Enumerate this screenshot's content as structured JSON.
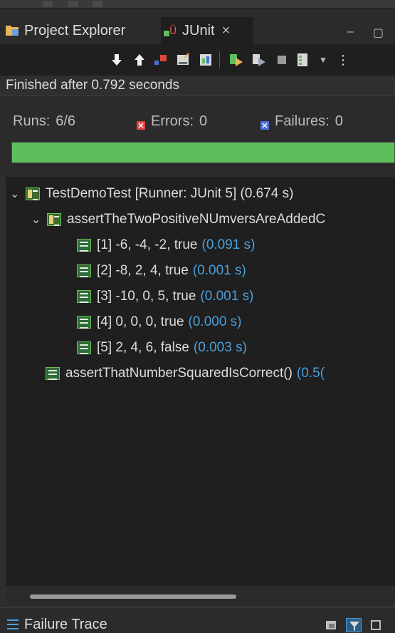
{
  "tabs": {
    "project_explorer": "Project Explorer",
    "junit": "JUnit",
    "close_glyph": "×"
  },
  "window_controls": {
    "minimize": "‒",
    "maximize": "▢"
  },
  "toolbar": {
    "icons": [
      "next-failure-icon",
      "previous-failure-icon",
      "show-failures-only-icon",
      "scroll-lock-icon",
      "show-skipped-icon",
      "rerun-icon",
      "rerun-failed-first-icon",
      "stop-icon",
      "history-icon",
      "dropdown-icon",
      "view-menu-icon"
    ]
  },
  "status": "Finished after 0.792 seconds",
  "counters": {
    "runs_label": "Runs:",
    "runs_value": "6/6",
    "errors_label": "Errors:",
    "errors_value": "0",
    "failures_label": "Failures:",
    "failures_value": "0"
  },
  "progress": {
    "fraction": 1.0,
    "color": "#5cbf5c"
  },
  "tree": {
    "root": {
      "label": "TestDemoTest [Runner: JUnit 5] (0.674 s)"
    },
    "group": {
      "label": "assertTheTwoPositiveNUmversAreAddedC"
    },
    "cases": [
      {
        "label": "[1] -6, -4, -2, true",
        "time": "(0.091 s)"
      },
      {
        "label": "[2] -8, 2, 4, true",
        "time": "(0.001 s)"
      },
      {
        "label": "[3] -10, 0, 5, true",
        "time": "(0.001 s)"
      },
      {
        "label": "[4] 0, 0, 0, true",
        "time": "(0.000 s)"
      },
      {
        "label": "[5] 2, 4, 6, false",
        "time": "(0.003 s)"
      }
    ],
    "single": {
      "label": "assertThatNumberSquaredIsCorrect()",
      "time": "(0.5("
    }
  },
  "bottom": {
    "label": "Failure Trace"
  },
  "colors": {
    "accent": "#4a9fdc",
    "pass": "#5cbf5c",
    "error": "#e0463e",
    "failure": "#4a6fd8"
  }
}
